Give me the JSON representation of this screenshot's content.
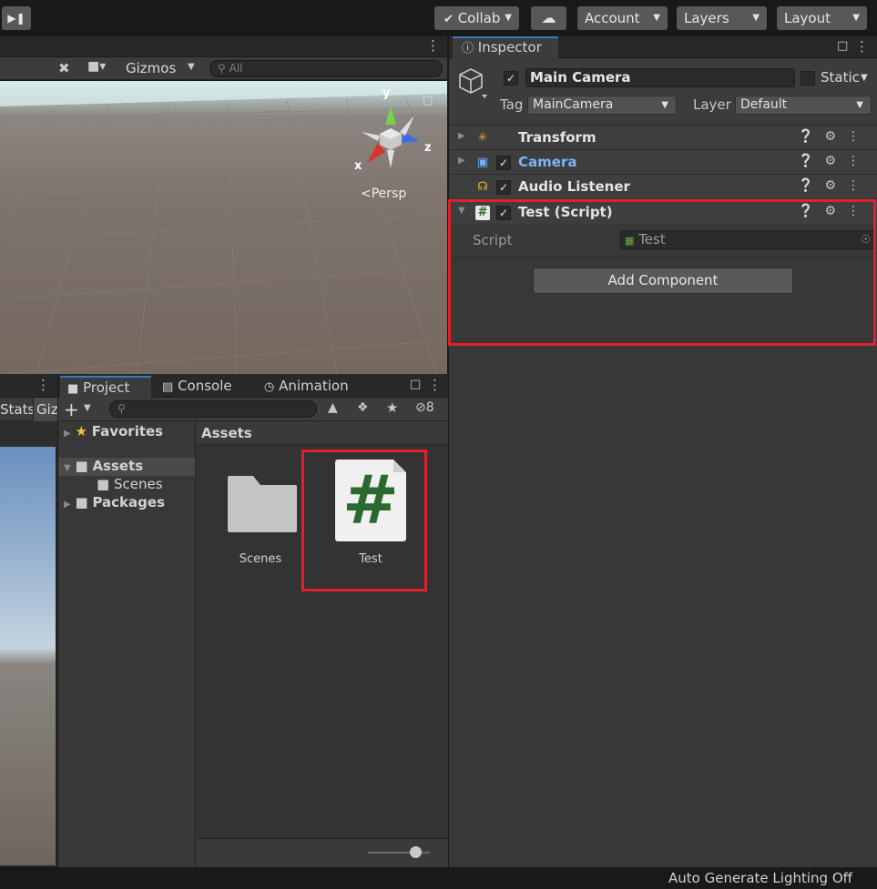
{
  "toolbar": {
    "collab_label": "Collab",
    "account_label": "Account",
    "layers_label": "Layers",
    "layout_label": "Layout"
  },
  "scene": {
    "gizmos_label": "Gizmos",
    "search_placeholder": "All",
    "persp_label": "Persp",
    "axis_x": "x",
    "axis_y": "y",
    "axis_z": "z"
  },
  "game": {
    "stats_label": "Stats",
    "gizmos_short": "Giz"
  },
  "inspector": {
    "tab_label": "Inspector",
    "object_name": "Main Camera",
    "static_label": "Static",
    "tag_label": "Tag",
    "tag_value": "MainCamera",
    "layer_label": "Layer",
    "layer_value": "Default",
    "components": [
      {
        "name": "Transform"
      },
      {
        "name": "Camera"
      },
      {
        "name": "Audio Listener"
      },
      {
        "name": "Test (Script)"
      }
    ],
    "script_field_label": "Script",
    "script_field_value": "Test",
    "add_component_label": "Add Component"
  },
  "project": {
    "tabs": [
      "Project",
      "Console",
      "Animation"
    ],
    "hidden_count": "8",
    "tree": {
      "favorites": "Favorites",
      "assets": "Assets",
      "scenes": "Scenes",
      "packages": "Packages"
    },
    "breadcrumb": "Assets",
    "assets": [
      {
        "name": "Scenes"
      },
      {
        "name": "Test"
      }
    ],
    "script_icon_glyph": "#"
  },
  "status": {
    "lighting_text": "Auto Generate Lighting Off"
  },
  "colors": {
    "highlight": "#e0202a",
    "camera_label": "#7fb4f5",
    "script_green": "#2b6a2e",
    "tab_accent": "#3a79bb"
  }
}
